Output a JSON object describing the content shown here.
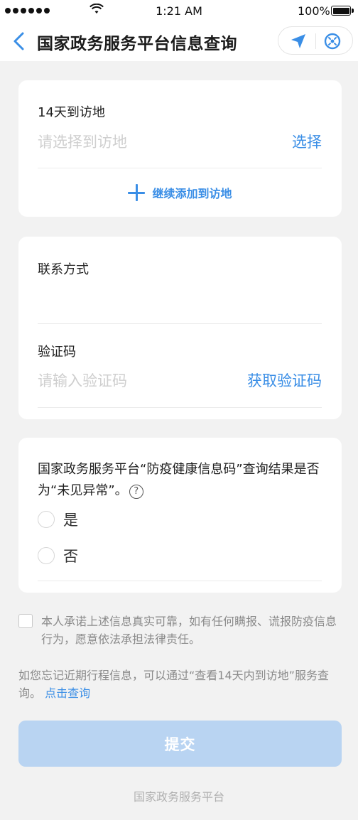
{
  "status_bar": {
    "time": "1:21 AM",
    "battery": "100%",
    "battery_level": 1.0
  },
  "nav": {
    "title": "国家政务服务平台信息查询",
    "icons": [
      "back-icon",
      "location-arrow-icon",
      "close-circle-icon"
    ]
  },
  "visit_card": {
    "label": "14天到访地",
    "placeholder": "请选择到访地",
    "select_label": "选择",
    "add_label": "继续添加到访地"
  },
  "contact_card": {
    "contact_label": "联系方式",
    "contact_value": "",
    "code_label": "验证码",
    "code_placeholder": "请输入验证码",
    "get_code_label": "获取验证码"
  },
  "question_card": {
    "question": "国家政务服务平台“防疫健康信息码”查询结果是否为“未见异常”。",
    "help_icon_glyph": "?",
    "options": [
      {
        "label": "是",
        "selected": false
      },
      {
        "label": "否",
        "selected": false
      }
    ]
  },
  "pledge": {
    "text": "本人承诺上述信息真实可靠，如有任何瞒报、谎报防疫信息行为，愿意依法承担法律责任。",
    "checked": false
  },
  "hint": {
    "text": "如您忘记近期行程信息，可以通过“查看14天内到访地”服务查询。",
    "link": "点击查询"
  },
  "submit_label": "提交",
  "footer": "国家政务服务平台",
  "colors": {
    "accent": "#3a8ee6",
    "submit_disabled": "#b9d4f2",
    "background": "#f2f2f2"
  }
}
